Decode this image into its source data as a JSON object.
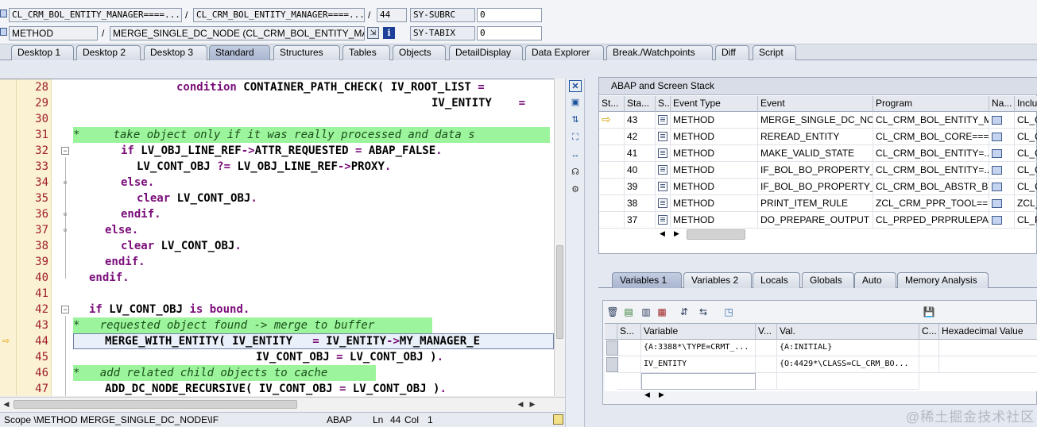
{
  "header": {
    "row1": {
      "program": "CL_CRM_BOL_ENTITY_MANAGER====...",
      "include": "CL_CRM_BOL_ENTITY_MANAGER====...",
      "line": "44",
      "var1_name": "SY-SUBRC",
      "var1_value": "0"
    },
    "row2": {
      "event_type": "METHOD",
      "event": "MERGE_SINGLE_DC_NODE (CL_CRM_BOL_ENTITY_MAN...",
      "var2_name": "SY-TABIX",
      "var2_value": "0"
    },
    "slash": "/"
  },
  "tabs": [
    "Desktop 1",
    "Desktop 2",
    "Desktop 3",
    "Standard",
    "Structures",
    "Tables",
    "Objects",
    "DetailDisplay",
    "Data Explorer",
    "Break./Watchpoints",
    "Diff",
    "Script"
  ],
  "active_tab": "Standard",
  "code": {
    "lines": [
      {
        "n": "28",
        "text": "condition CONTAINER_PATH_CHECK( IV_ROOT_LIST ="
      },
      {
        "n": "29",
        "text": "IV_ENTITY    ="
      },
      {
        "n": "30",
        "text": ""
      },
      {
        "n": "31",
        "text": "*     take object only if it was really processed and data s"
      },
      {
        "n": "32",
        "text": "if LV_OBJ_LINE_REF->ATTR_REQUESTED = ABAP_FALSE."
      },
      {
        "n": "33",
        "text": "LV_CONT_OBJ ?= LV_OBJ_LINE_REF->PROXY."
      },
      {
        "n": "34",
        "text": "else."
      },
      {
        "n": "35",
        "text": "clear LV_CONT_OBJ."
      },
      {
        "n": "36",
        "text": "endif."
      },
      {
        "n": "37",
        "text": "else."
      },
      {
        "n": "38",
        "text": "clear LV_CONT_OBJ."
      },
      {
        "n": "39",
        "text": "endif."
      },
      {
        "n": "40",
        "text": "endif."
      },
      {
        "n": "41",
        "text": ""
      },
      {
        "n": "42",
        "text": "if LV_CONT_OBJ is bound."
      },
      {
        "n": "43",
        "text": "*   requested object found -> merge to buffer"
      },
      {
        "n": "44",
        "text": "MERGE_WITH_ENTITY( IV_ENTITY   = IV_ENTITY->MY_MANAGER_E"
      },
      {
        "n": "45",
        "text": "IV_CONT_OBJ = LV_CONT_OBJ )."
      },
      {
        "n": "46",
        "text": "*   add related child objects to cache"
      },
      {
        "n": "47",
        "text": "ADD_DC_NODE_RECURSIVE( IV_CONT_OBJ = LV_CONT_OBJ )."
      }
    ]
  },
  "status_bar": {
    "scope": "Scope \\METHOD MERGE_SINGLE_DC_NODE\\IF",
    "language": "ABAP",
    "ln_label": "Ln",
    "ln": "44",
    "col_label": "Col",
    "col": "1"
  },
  "stack": {
    "title": "ABAP and Screen Stack",
    "columns": [
      "St...",
      "Sta...",
      "S...",
      "Event Type",
      "Event",
      "Program",
      "Na...",
      "Inclu"
    ],
    "rows": [
      {
        "level": "43",
        "event_type": "METHOD",
        "event": "MERGE_SINGLE_DC_NO...",
        "program": "CL_CRM_BOL_ENTITY_M...",
        "include": "CL_C"
      },
      {
        "level": "42",
        "event_type": "METHOD",
        "event": "REREAD_ENTITY",
        "program": "CL_CRM_BOL_CORE===...",
        "include": "CL_C"
      },
      {
        "level": "41",
        "event_type": "METHOD",
        "event": "MAKE_VALID_STATE",
        "program": "CL_CRM_BOL_ENTITY=...",
        "include": "CL_C"
      },
      {
        "level": "40",
        "event_type": "METHOD",
        "event": "IF_BOL_BO_PROPERTY_...",
        "program": "CL_CRM_BOL_ENTITY=...",
        "include": "CL_C"
      },
      {
        "level": "39",
        "event_type": "METHOD",
        "event": "IF_BOL_BO_PROPERTY_...",
        "program": "CL_CRM_BOL_ABSTR_B...",
        "include": "CL_C"
      },
      {
        "level": "38",
        "event_type": "METHOD",
        "event": "PRINT_ITEM_RULE",
        "program": "ZCL_CRM_PPR_TOOL==...",
        "include": "ZCL_"
      },
      {
        "level": "37",
        "event_type": "METHOD",
        "event": "DO_PREPARE_OUTPUT",
        "program": "CL_PRPED_PRPRULEPAR...",
        "include": "CL_P"
      }
    ]
  },
  "variables": {
    "tabs": [
      "Variables 1",
      "Variables 2",
      "Locals",
      "Globals",
      "Auto",
      "Memory Analysis"
    ],
    "active_tab": "Variables 1",
    "columns": [
      "S...",
      "Variable",
      "V...",
      "Val.",
      "C...",
      "Hexadecimal Value"
    ],
    "rows": [
      {
        "variable": "{A:3388*\\TYPE=CRMT_...",
        "value": "{A:INITIAL}"
      },
      {
        "variable": "IV_ENTITY",
        "value": "{O:4429*\\CLASS=CL_CRM_BO..."
      },
      {
        "variable": "",
        "value": ""
      }
    ]
  },
  "watermark": "@稀土掘金技术社区",
  "colors": {
    "keyword": "#7a0d7a",
    "comment_bg": "#9cf59c",
    "line_number": "#a0202a",
    "gutter_bg": "#fbf2d3",
    "active_tab": "#a9b5cf"
  }
}
